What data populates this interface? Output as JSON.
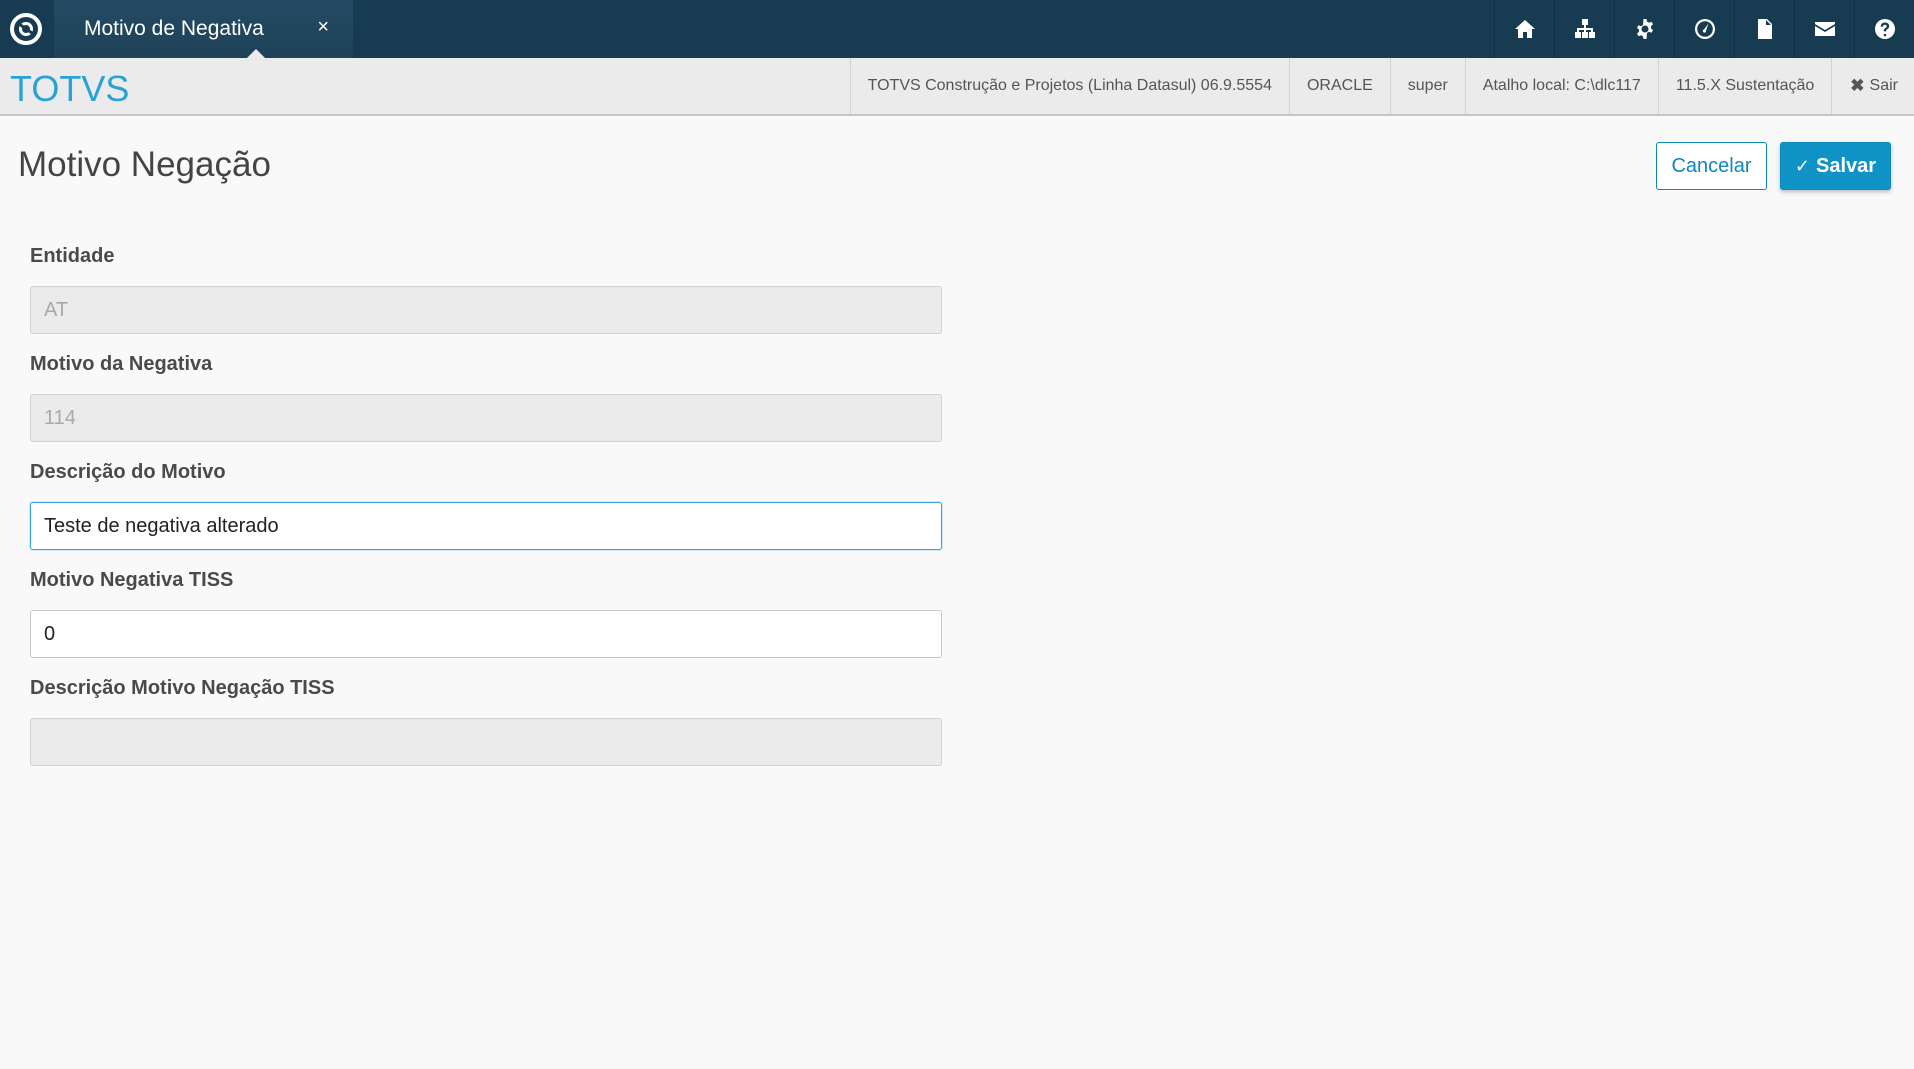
{
  "topbar": {
    "tab_label": "Motivo de Negativa",
    "tab_close": "×",
    "icons": [
      "home-icon",
      "sitemap-icon",
      "gear-icon",
      "speedometer-icon",
      "document-icon",
      "mail-icon",
      "help-icon"
    ]
  },
  "subbar": {
    "brand": "TOTVS",
    "product": "TOTVS Construção e Projetos (Linha Datasul) 06.9.5554",
    "database": "ORACLE",
    "user": "super",
    "shortcut": "Atalho local: C:\\dlc117",
    "version": "11.5.X Sustentação",
    "exit_icon": "✖",
    "exit_label": "Sair"
  },
  "page": {
    "title": "Motivo Negação",
    "cancel_label": "Cancelar",
    "save_check": "✓",
    "save_label": "Salvar"
  },
  "form": {
    "entidade_label": "Entidade",
    "entidade_value": "AT",
    "motivo_label": "Motivo da Negativa",
    "motivo_value": "114",
    "descricao_label": "Descrição do Motivo",
    "descricao_value": "Teste de negativa alterado",
    "tiss_label": "Motivo Negativa TISS",
    "tiss_value": "0",
    "desc_tiss_label": "Descrição Motivo Negação TISS",
    "desc_tiss_value": ""
  },
  "colors": {
    "topbar": "#173c52",
    "brand": "#29a3d6",
    "primary": "#0f93c6"
  }
}
